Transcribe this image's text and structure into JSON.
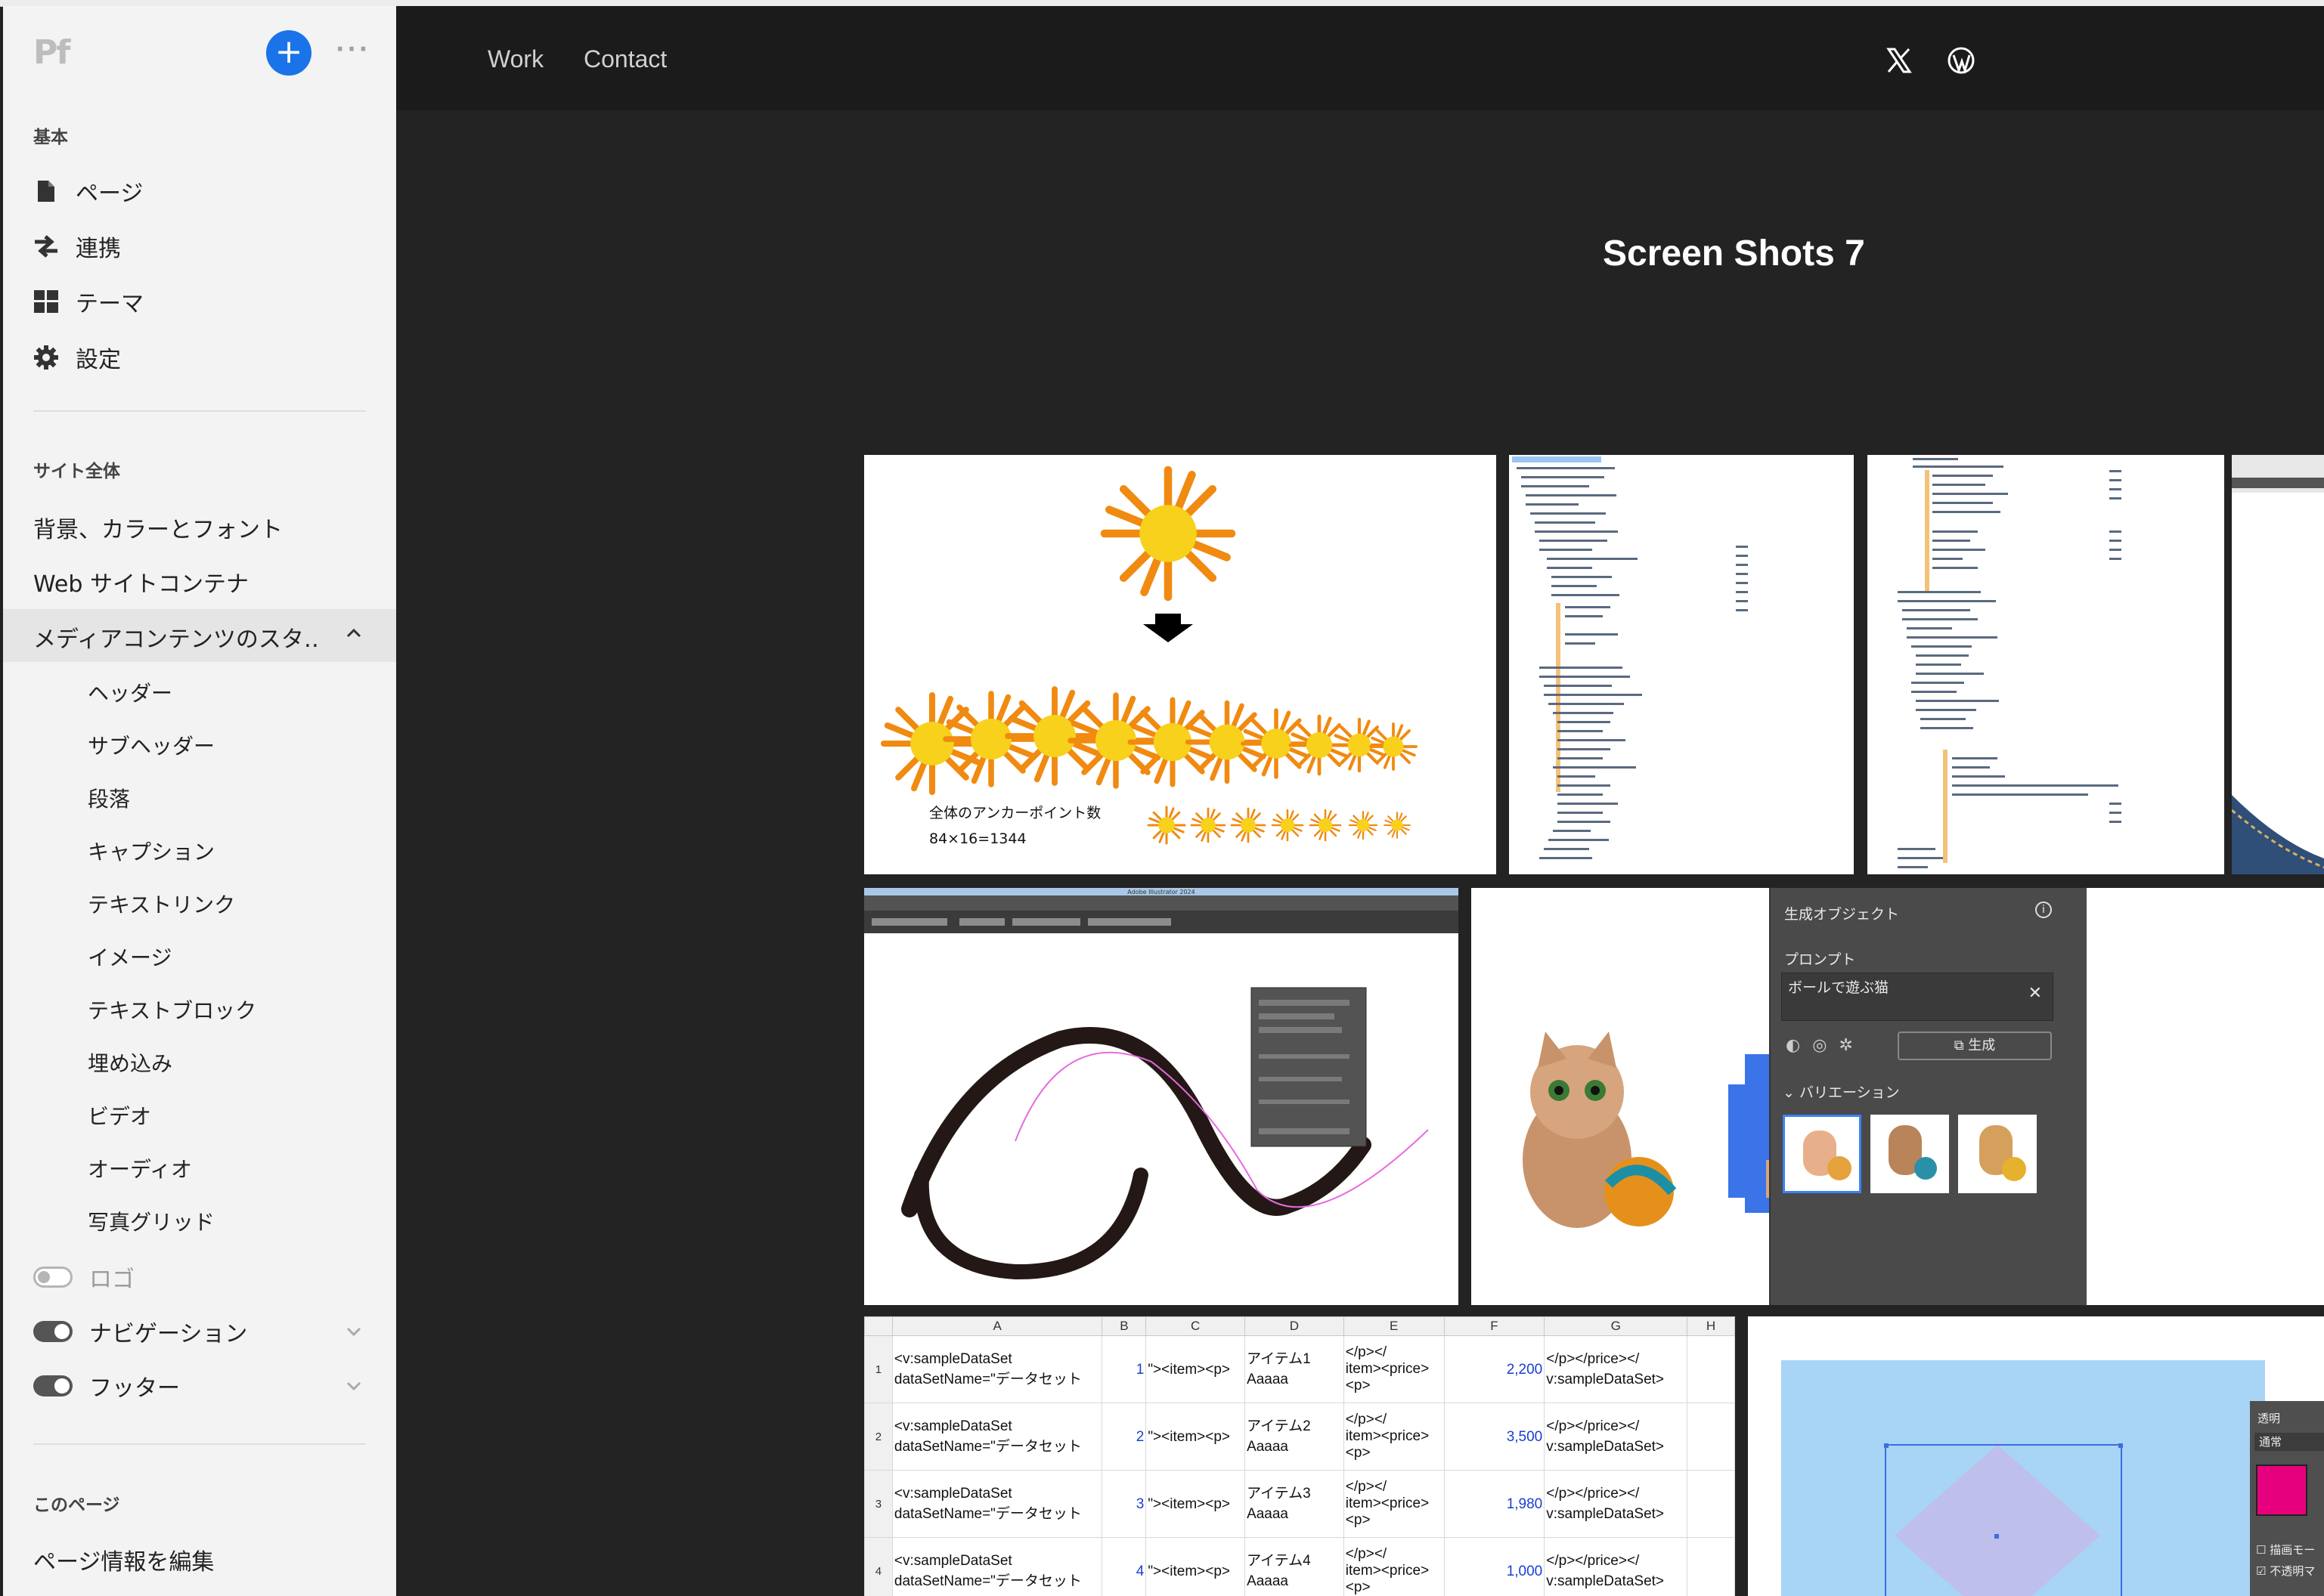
{
  "sidebar": {
    "logo": "Pf",
    "add_label": "+",
    "more_label": "···",
    "basic_title": "基本",
    "basic_items": [
      {
        "label": "ページ",
        "icon": "page-icon"
      },
      {
        "label": "連携",
        "icon": "link-arrows-icon"
      },
      {
        "label": "テーマ",
        "icon": "layout-icon"
      },
      {
        "label": "設定",
        "icon": "gear-icon"
      }
    ],
    "site_title": "サイト全体",
    "site_links": [
      "背景、カラーとフォント",
      "Web サイトコンテナ"
    ],
    "selected_section": "メディアコンテンツのスタ…",
    "sub_items": [
      "ヘッダー",
      "サブヘッダー",
      "段落",
      "キャプション",
      "テキストリンク",
      "イメージ",
      "テキストブロック",
      "埋め込み",
      "ビデオ",
      "オーディオ",
      "写真グリッド"
    ],
    "toggles": [
      {
        "label": "ロゴ",
        "state": "off"
      },
      {
        "label": "ナビゲーション",
        "state": "on"
      },
      {
        "label": "フッター",
        "state": "on"
      }
    ],
    "this_page_title": "このページ",
    "edit_page_info": "ページ情報を編集"
  },
  "header": {
    "menu": [
      "Work",
      "Contact"
    ],
    "social_icons": [
      "x-icon",
      "wordpress-icon"
    ]
  },
  "page_title": "Screen Shots 7",
  "tiles": {
    "flower": {
      "caption_line1": "全体のアンカーポイント数",
      "caption_line2": "84×16=1344"
    },
    "illustrator_title": "Adobe Illustrator 2024",
    "gen_panel": {
      "title": "生成オブジェクト",
      "prompt_label": "プロンプト",
      "prompt_value": "ボールで遊ぶ猫",
      "generate_button": "生成",
      "variations_label": "バリエーション"
    },
    "spreadsheet": {
      "columns": [
        "A",
        "B",
        "C",
        "D",
        "E",
        "F",
        "G",
        "H"
      ],
      "rows": [
        {
          "n": "1",
          "a1": "<v:sampleDataSet",
          "a2": "dataSetName=\"データセット",
          "b": "1",
          "c": "\"><item><p>",
          "d1": "アイテム1",
          "d2": "Aaaaa",
          "e1": "</p></",
          "e2": "item><price>",
          "e3": "<p>",
          "f": "2,200",
          "g1": "</p></price></",
          "g2": "v:sampleDataSet>"
        },
        {
          "n": "2",
          "a1": "<v:sampleDataSet",
          "a2": "dataSetName=\"データセット",
          "b": "2",
          "c": "\"><item><p>",
          "d1": "アイテム2",
          "d2": "Aaaaa",
          "e1": "</p></",
          "e2": "item><price>",
          "e3": "<p>",
          "f": "3,500",
          "g1": "</p></price></",
          "g2": "v:sampleDataSet>"
        },
        {
          "n": "3",
          "a1": "<v:sampleDataSet",
          "a2": "dataSetName=\"データセット",
          "b": "3",
          "c": "\"><item><p>",
          "d1": "アイテム3",
          "d2": "Aaaaa",
          "e1": "</p></",
          "e2": "item><price>",
          "e3": "<p>",
          "f": "1,980",
          "g1": "</p></price></",
          "g2": "v:sampleDataSet>"
        },
        {
          "n": "4",
          "a1": "<v:sampleDataSet",
          "a2": "dataSetName=\"データセット",
          "b": "4",
          "c": "\"><item><p>",
          "d1": "アイテム4",
          "d2": "Aaaaa",
          "e1": "</p></",
          "e2": "item><price>",
          "e3": "<p>",
          "f": "1,000",
          "g1": "</p></price></",
          "g2": "v:sampleDataSet>"
        }
      ]
    },
    "transparency_panel": {
      "title": "透明",
      "mode": "通常",
      "check1": "描画モー",
      "check2": "不透明マ"
    }
  },
  "colors": {
    "accent": "#1a73e8",
    "magenta": "#e6007e"
  }
}
